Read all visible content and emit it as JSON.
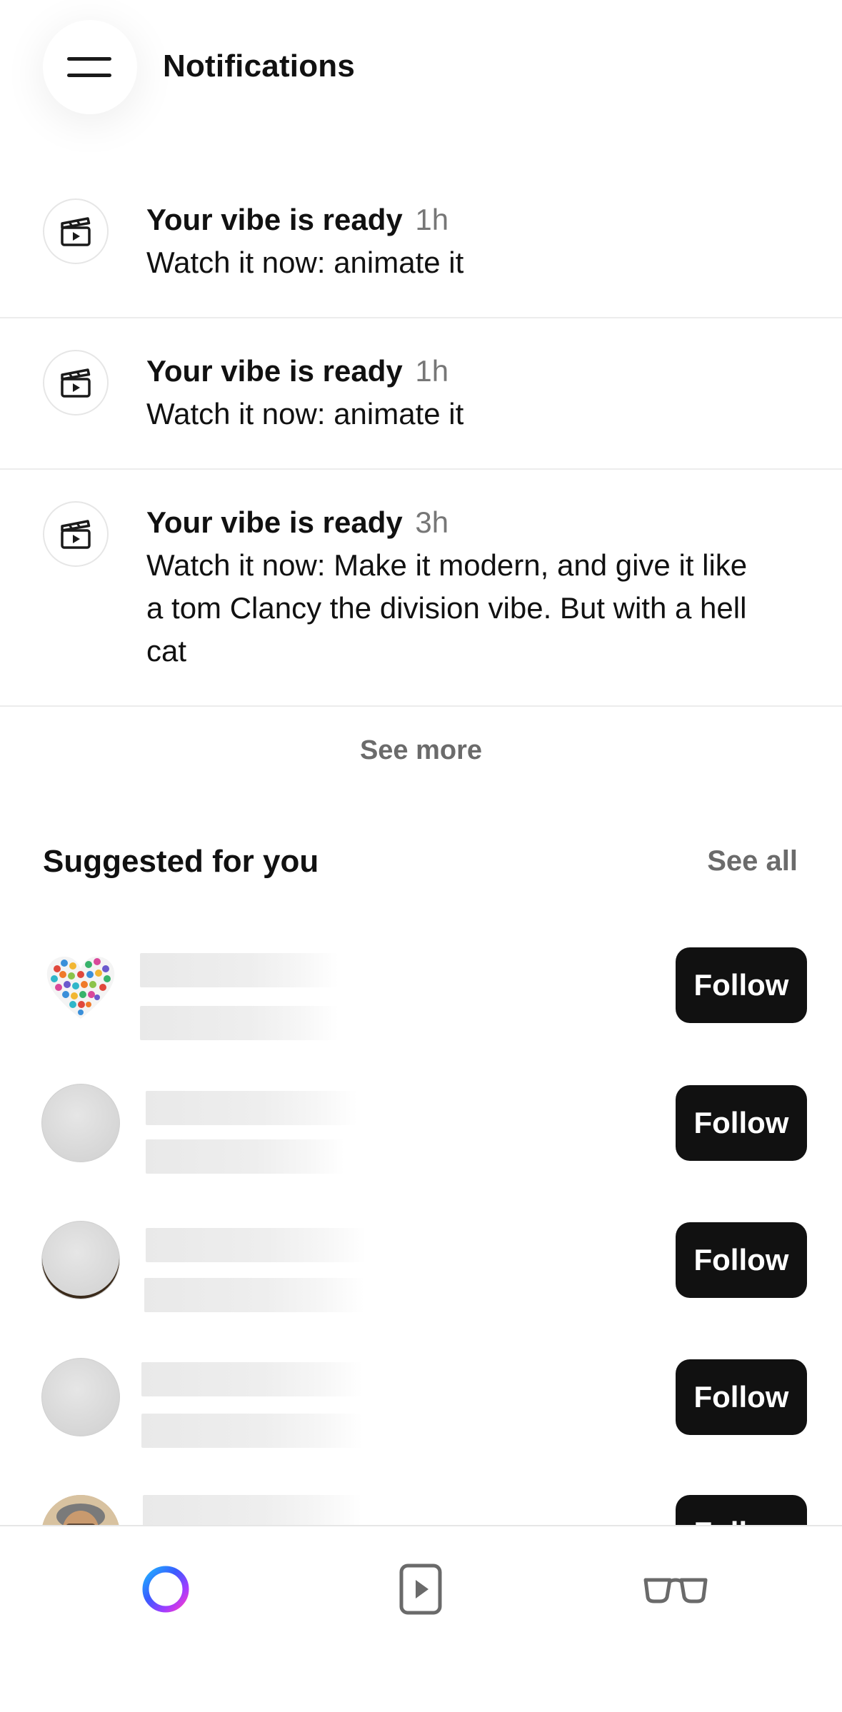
{
  "header": {
    "title": "Notifications",
    "menu_icon": "hamburger-menu-icon"
  },
  "notifications": [
    {
      "icon": "clapperboard-icon",
      "title": "Your vibe is ready",
      "time": "1h",
      "body": "Watch it now: animate it"
    },
    {
      "icon": "clapperboard-icon",
      "title": "Your vibe is ready",
      "time": "1h",
      "body": "Watch it now: animate it"
    },
    {
      "icon": "clapperboard-icon",
      "title": "Your vibe is ready",
      "time": "3h",
      "body": "Watch it now: Make it modern, and give it like a tom Clancy the division vibe. But with a hell cat"
    }
  ],
  "see_more_label": "See more",
  "suggested": {
    "title": "Suggested for you",
    "see_all_label": "See all",
    "follow_label": "Follow"
  },
  "bottom_nav": {
    "items": [
      {
        "icon": "ai-ring-icon"
      },
      {
        "icon": "play-video-icon"
      },
      {
        "icon": "glasses-icon"
      }
    ]
  },
  "colors": {
    "button_bg": "#111111",
    "button_text": "#ffffff",
    "muted_text": "#6b6b6b",
    "divider": "#ececec"
  }
}
